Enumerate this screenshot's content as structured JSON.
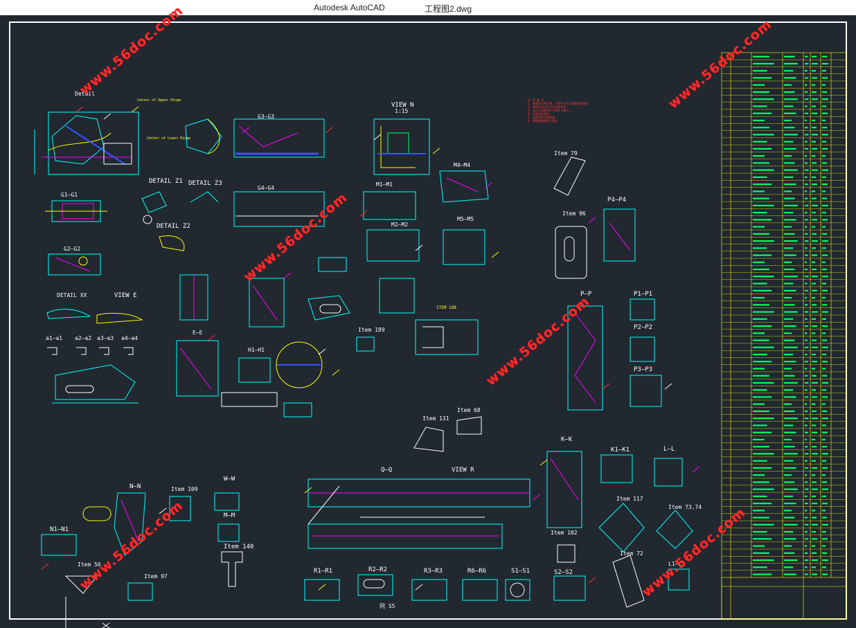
{
  "window": {
    "app_title": "Autodesk AutoCAD",
    "document_title": "工程图2.dwg"
  },
  "watermark": {
    "text": "www.56doc.com",
    "color": "#ff2a2a"
  },
  "colors": {
    "canvas_bg": "#212830",
    "frame": "#ffffff",
    "cyan": "#00ffff",
    "yellow": "#ffff00",
    "magenta": "#ff00ff",
    "red": "#ff3333",
    "blue": "#3355ff",
    "green": "#00ff66"
  },
  "labels": {
    "detail": "Detail",
    "hinge_upper": "Center of Upper Hinge",
    "hinge_lower": "Center of Lower Hinge",
    "g1g1": "G1—G1",
    "g2g2": "G2—G2",
    "g3g3": "G3—G3",
    "g4g4": "G4—G4",
    "detail_z1": "DETAIL Z1",
    "detail_z2": "DETAIL Z2",
    "detail_z3": "DETAIL Z3",
    "detail_xx": "DETAIL XX",
    "view_e": "VIEW E",
    "view_n": "VIEW N",
    "view_n_scale": "1:15",
    "view_r": "VIEW R",
    "m1m1": "M1—M1",
    "m2m2": "M2—M2",
    "m4m4": "M4—M4",
    "m5m5": "M5—M5",
    "item79": "Item 79",
    "item96": "Item 96",
    "p4p4": "P4—P4",
    "pp": "P—P",
    "p1p1": "P1—P1",
    "p2p2": "P2—P2",
    "p3p3": "P3—P3",
    "item189": "Item 189",
    "item_yellow": "ITEM 188",
    "h1h1": "H1—H1",
    "ee": "E—E",
    "item131": "Item 131",
    "item68": "Item 68",
    "kk": "K—K",
    "k1k1": "K1—K1",
    "ll": "L—L",
    "item117": "Item 117",
    "item73": "Item 73,74",
    "item72": "Item 72",
    "l1l1": "L1—L1",
    "nn": "N—N",
    "n1n1": "N1—N1",
    "ww": "W—W",
    "mm": "M—M",
    "item140": "Item 140",
    "item109": "Item 109",
    "item56": "Item 56",
    "item97": "Item 97",
    "item102": "Item 102",
    "qq": "Q—Q",
    "r1r1": "R1—R1",
    "r2r2": "R2—R2",
    "r3r3": "R3—R3",
    "r6r6": "R6—R6",
    "s1s1": "S1—S1",
    "s2s2": "S2—S2",
    "same_s5": "同 S5",
    "sections": [
      "a1—a1",
      "a2—a2",
      "a3—a3",
      "a4—a4"
    ]
  },
  "notes_text": "技 术 要 求\n1. 焊缝须平整光滑，不得有气孔夹渣裂纹等缺陷\n2. 焊接后须进行应力消除处理\n3. 未注公差按GB/T1804-m执行\n4. 所有锐边倒钝\n5. 表面涂防锈漆两遍\n6. 焊缝高度按图示要求",
  "bom": {
    "row_count": 74
  }
}
